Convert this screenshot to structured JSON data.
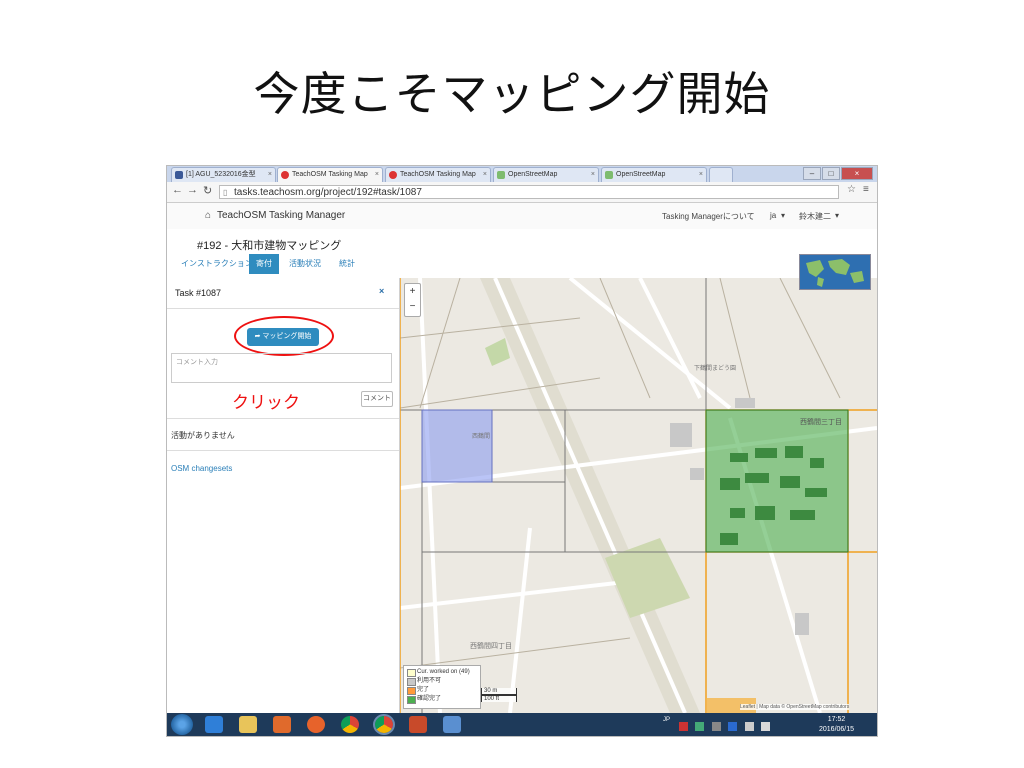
{
  "slide": {
    "title": "今度こそマッピング開始"
  },
  "browser": {
    "tabs": [
      {
        "label": "[1] AGU_5232016金型",
        "icon_color": "#3b5998"
      },
      {
        "label": "TeachOSM Tasking Map",
        "icon_color": "#d33"
      },
      {
        "label": "TeachOSM Tasking Map",
        "icon_color": "#d33"
      },
      {
        "label": "OpenStreetMap",
        "icon_color": "#7ebc6f"
      },
      {
        "label": "OpenStreetMap",
        "icon_color": "#7ebc6f"
      }
    ],
    "url": "tasks.teachosm.org/project/192#task/1087"
  },
  "app": {
    "brand": "TeachOSM Tasking Manager",
    "about": "Tasking Managerについて",
    "lang": "ja",
    "user": "鈴木建二"
  },
  "project": {
    "title": "#192 - 大和市建物マッピング",
    "tabs": [
      "インストラクション",
      "寄付",
      "活動状況",
      "統計"
    ]
  },
  "task": {
    "title": "Task #1087",
    "close": "×",
    "start_button": "マッピング開始",
    "comment_placeholder": "コメント入力",
    "annotation": "クリック",
    "stop_button": "コメント",
    "activity": "活動がありません",
    "changesets": "OSM changesets"
  },
  "map": {
    "labels": [
      "下鶴間まどう園",
      "西鶴間三丁目",
      "西鶴間四丁目",
      "西鶴間"
    ],
    "legend": [
      {
        "label": "Cur. worked on (49)",
        "color": "#ffffcc"
      },
      {
        "label": "利用不可",
        "color": "#c8c8c8"
      },
      {
        "label": "完了",
        "color": "#ff9a3a"
      },
      {
        "label": "確認完了",
        "color": "#4caf50"
      }
    ],
    "scale": [
      "30 m",
      "100 ft"
    ],
    "attribution": "Leaflet | Map data © OpenStreetMap contributors"
  },
  "taskbar": {
    "ime": "JP",
    "time": "17:52",
    "date": "2016/06/15"
  },
  "colors": {
    "accent": "#2f8cbf",
    "annotation": "#e11111",
    "locked_task": "#8c9df0",
    "validated_task": "#4caf50",
    "grid": "#f0a020"
  }
}
